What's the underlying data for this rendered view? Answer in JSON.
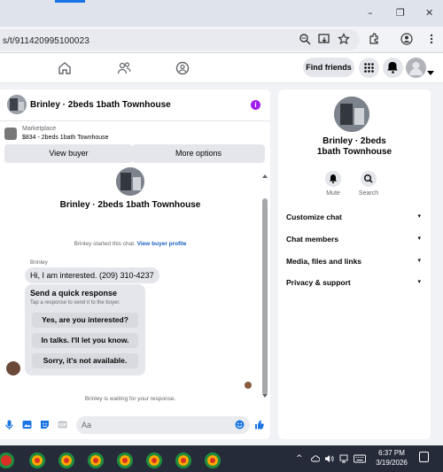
{
  "browser": {
    "url": "s/t/911420995100023",
    "window_controls": [
      "–",
      "❐",
      "✕"
    ]
  },
  "fb_nav": {
    "find_friends_label": "Find friends"
  },
  "chat": {
    "header_title": "Brinley · 2beds 1bath Townhouse",
    "marketplace_label": "Marketplace",
    "listing_line": "$834 - 2beds 1bath Townhouse",
    "view_buyer_label": "View buyer",
    "more_options_label": "More options",
    "center_title": "Brinley · 2beds 1bath Townhouse",
    "started_text": "Brinley started this chat.",
    "view_profile_link": "View buyer profile",
    "sender_name": "Brinley",
    "first_message": "Hi, I am interested. (209) 310-4237",
    "quick_response": {
      "title": "Send a quick response",
      "subtitle": "Tap a response to send it to the buyer.",
      "options": [
        "Yes, are you interested?",
        "In talks. I'll let you know.",
        "Sorry, it's not available."
      ]
    },
    "waiting_text": "Brinley is waiting for your response.",
    "compose_placeholder": "Aa"
  },
  "info_panel": {
    "title": "Brinley · 2beds 1bath Townhouse",
    "actions": [
      {
        "label": "Mute",
        "icon": "bell-icon"
      },
      {
        "label": "Search",
        "icon": "search-icon"
      }
    ],
    "sections": [
      "Customize chat",
      "Chat members",
      "Media, files and links",
      "Privacy & support"
    ]
  },
  "taskbar": {
    "time": "6:37 PM",
    "date": "3/19/2026",
    "app_count": 7
  },
  "colors": {
    "accent": "#1b74e4",
    "info_purple": "#a020f0",
    "taskbar": "#262b3a"
  }
}
